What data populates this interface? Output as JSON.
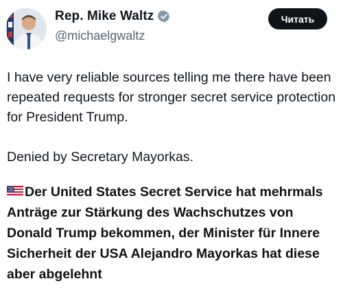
{
  "profile": {
    "display_name": "Rep. Mike Waltz",
    "handle": "@michaelgwaltz",
    "verified": true,
    "avatar_icon": "profile-photo"
  },
  "actions": {
    "follow_label": "Читать"
  },
  "tweet": {
    "line1": "I have very reliable sources telling me there have been repeated requests for stronger secret service protection for President Trump.",
    "line2": "Denied by Secretary Mayorkas."
  },
  "caption": {
    "flag_icon": "us-flag-icon",
    "text": "Der United States Secret Service hat mehrmals Anträge zur Stärkung des Wachschutzes von Donald Trump bekommen, der Minister für Innere Sicherheit der USA Alejandro Mayorkas hat diese aber abgelehnt"
  },
  "colors": {
    "text": "#0f1419",
    "secondary": "#536471",
    "button_bg": "#0f1419",
    "verified": "#829aab"
  }
}
